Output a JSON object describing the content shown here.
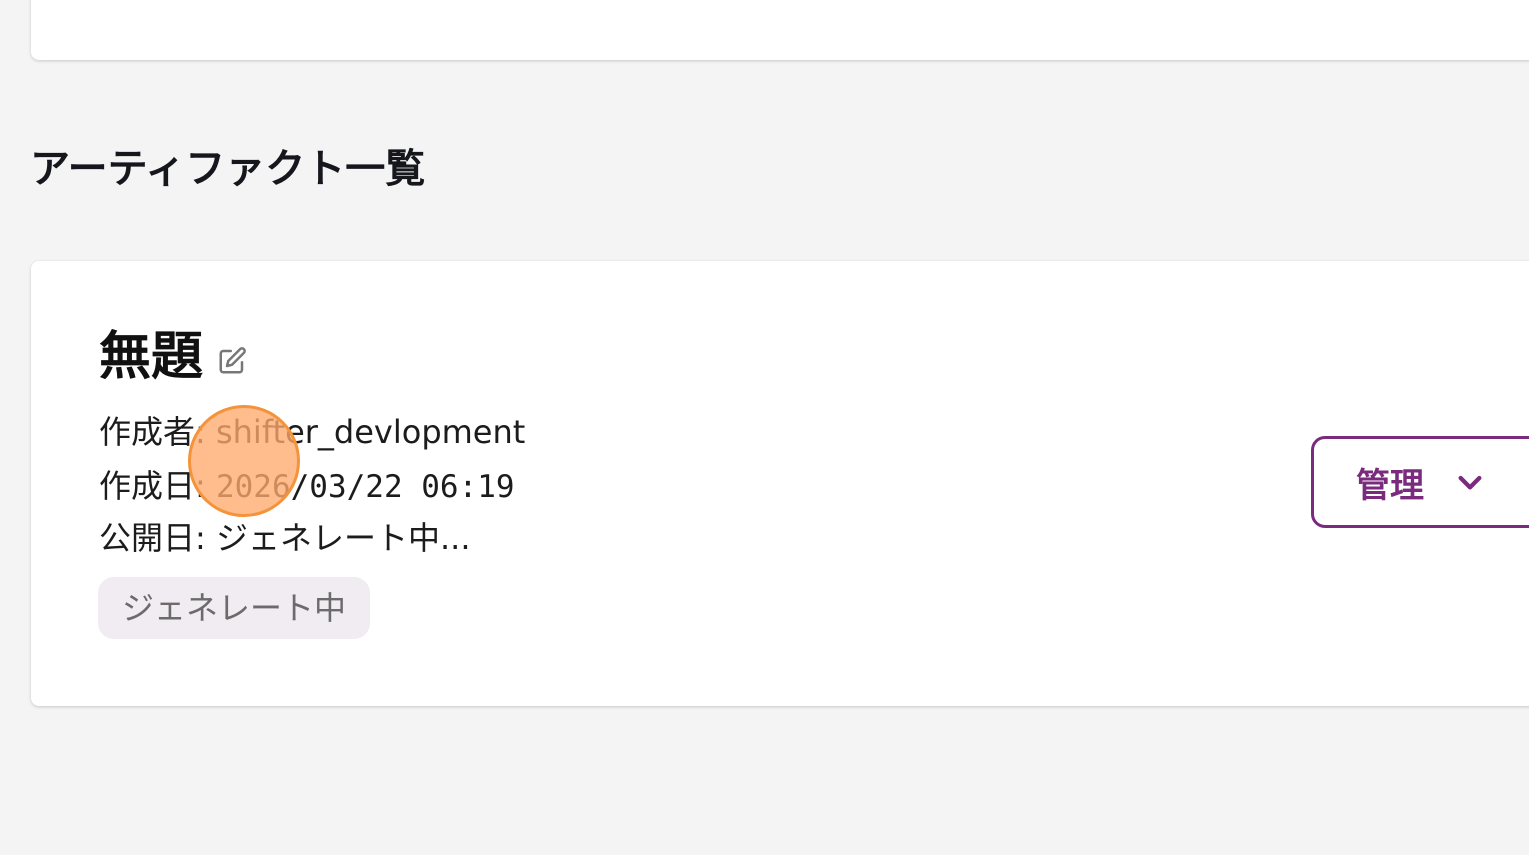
{
  "section": {
    "title": "アーティファクト一覧"
  },
  "artifact": {
    "title": "無題",
    "author_label": "作成者: ",
    "author_value": "shifter_devlopment",
    "created_label": "作成日: ",
    "created_value": "2026/03/22 06:19",
    "published_label": "公開日: ",
    "published_value": "ジェネレート中...",
    "status_badge": "ジェネレート中",
    "manage_button": "管理"
  },
  "icons": {
    "edit": "pencil-edit-icon",
    "manage_dropdown": "chevron-down-icon"
  },
  "colors": {
    "background": "#f4f4f4",
    "card": "#ffffff",
    "accent": "#7a2b7d",
    "badge_bg": "#f1ebf2",
    "badge_text": "#6b6b6b",
    "click_indicator": "#f5933b"
  }
}
